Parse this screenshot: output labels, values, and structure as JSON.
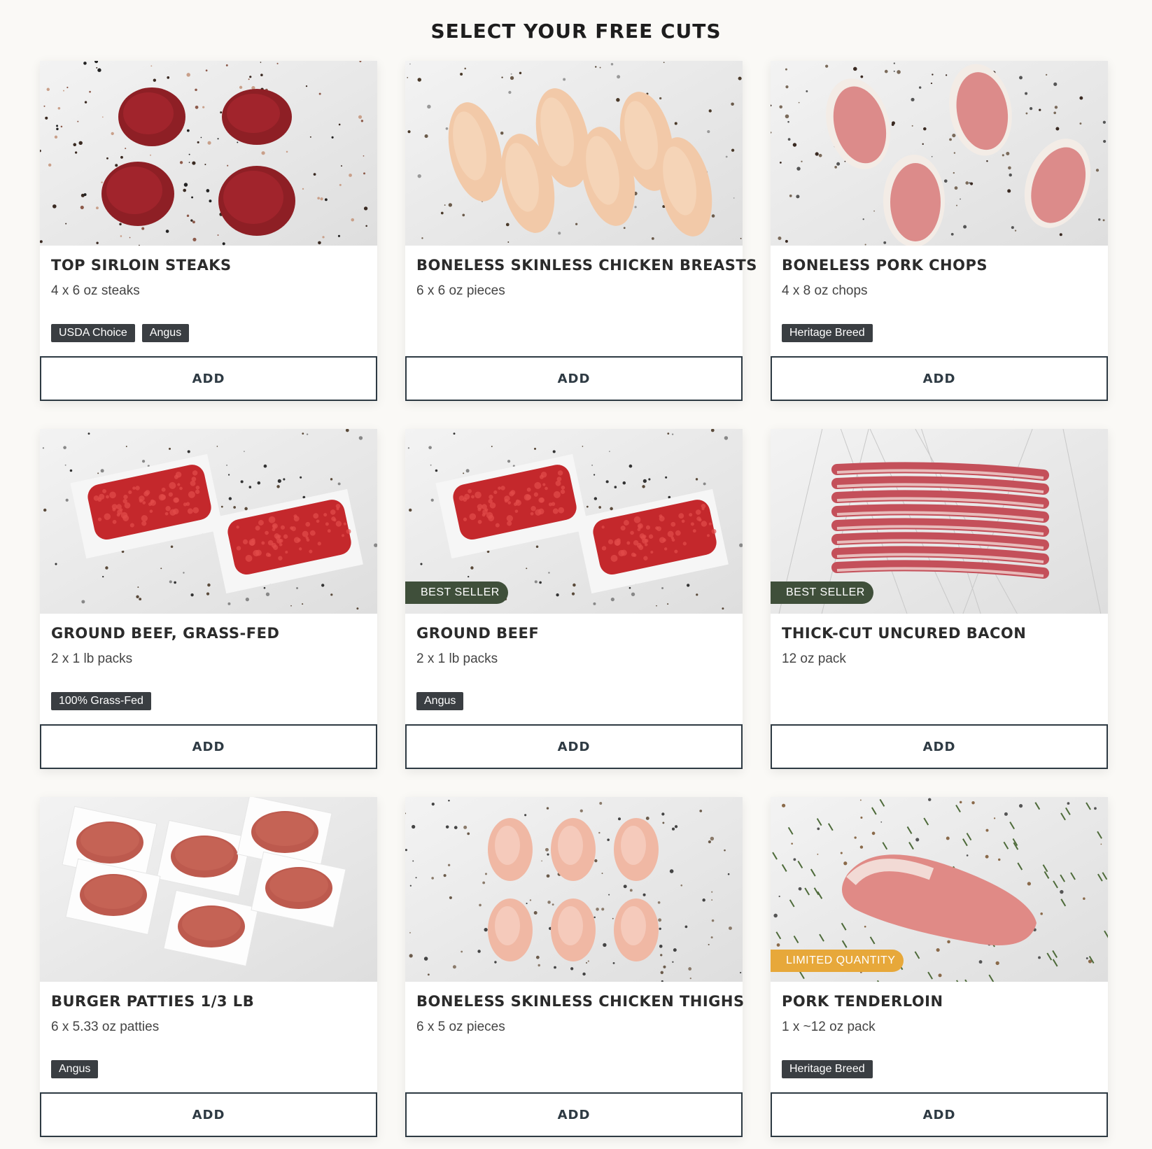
{
  "page": {
    "title": "SELECT YOUR FREE CUTS"
  },
  "colors": {
    "badge_bg": "#3a3e42",
    "best_seller": "#3f4f3a",
    "limited": "#e7a83a",
    "button_border": "#2e3a43"
  },
  "products": [
    {
      "name": "TOP SIRLOIN STEAKS",
      "detail": "4 x 6 oz steaks",
      "badges": [
        "USDA Choice",
        "Angus"
      ],
      "flag": "",
      "button": "ADD",
      "photo_icon": "steak-photo"
    },
    {
      "name": "BONELESS SKINLESS CHICKEN BREASTS",
      "detail": "6 x 6 oz pieces",
      "badges": [],
      "flag": "",
      "button": "ADD",
      "photo_icon": "chicken-breast-photo"
    },
    {
      "name": "BONELESS PORK CHOPS",
      "detail": "4 x 8 oz chops",
      "badges": [
        "Heritage Breed"
      ],
      "flag": "",
      "button": "ADD",
      "photo_icon": "pork-chop-photo"
    },
    {
      "name": "GROUND BEEF, GRASS-FED",
      "detail": "2 x 1 lb packs",
      "badges": [
        "100% Grass-Fed"
      ],
      "flag": "",
      "button": "ADD",
      "photo_icon": "ground-beef-photo"
    },
    {
      "name": "GROUND BEEF",
      "detail": "2 x 1 lb packs",
      "badges": [
        "Angus"
      ],
      "flag": "BEST SELLER",
      "button": "ADD",
      "photo_icon": "ground-beef-photo"
    },
    {
      "name": "THICK-CUT UNCURED BACON",
      "detail": "12 oz pack",
      "badges": [],
      "flag": "BEST SELLER",
      "button": "ADD",
      "photo_icon": "bacon-photo"
    },
    {
      "name": "BURGER PATTIES 1/3 LB",
      "detail": "6 x 5.33 oz patties",
      "badges": [
        "Angus"
      ],
      "flag": "",
      "button": "ADD",
      "photo_icon": "burger-patty-photo"
    },
    {
      "name": "BONELESS SKINLESS CHICKEN THIGHS",
      "detail": "6 x 5 oz pieces",
      "badges": [],
      "flag": "",
      "button": "ADD",
      "photo_icon": "chicken-thigh-photo"
    },
    {
      "name": "PORK TENDERLOIN",
      "detail": "1 x ~12 oz pack",
      "badges": [
        "Heritage Breed"
      ],
      "flag": "LIMITED QUANTITY",
      "button": "ADD",
      "photo_icon": "pork-tenderloin-photo"
    }
  ]
}
